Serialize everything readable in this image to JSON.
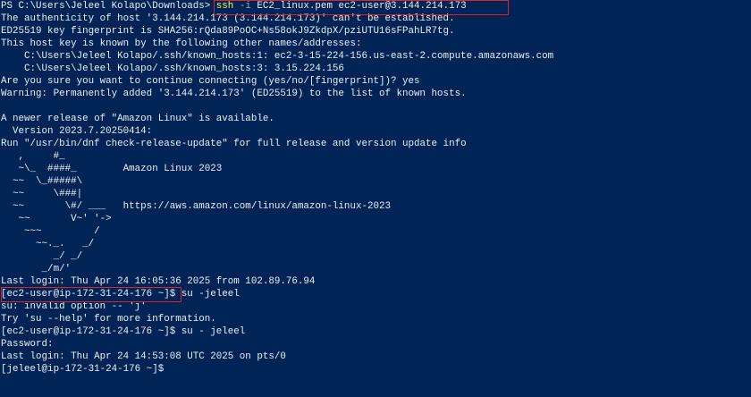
{
  "terminal": {
    "background": "#012456",
    "highlight_box_color": "#e0232b",
    "prompt_ps": "PS C:\\Users\\Jeleel Kolapo\\Downloads> ",
    "cmd_ssh": "ssh",
    "cmd_flag": " -i",
    "cmd_rest": " EC2_linux.pem ec2-user@3.144.214.173",
    "lines": [
      "The authenticity of host '3.144.214.173 (3.144.214.173)' can't be established.",
      "ED25519 key fingerprint is SHA256:rQda89PoOC+Ns58okJ9ZkdpX/pziUTU16sFPahLR7tg.",
      "This host key is known by the following other names/addresses:",
      "    C:\\Users\\Jeleel Kolapo/.ssh/known_hosts:1: ec2-3-15-224-156.us-east-2.compute.amazonaws.com",
      "    C:\\Users\\Jeleel Kolapo/.ssh/known_hosts:3: 3.15.224.156",
      "Are you sure you want to continue connecting (yes/no/[fingerprint])? yes",
      "Warning: Permanently added '3.144.214.173' (ED25519) to the list of known hosts.",
      "",
      "A newer release of \"Amazon Linux\" is available.",
      "  Version 2023.7.20250414:",
      "Run \"/usr/bin/dnf check-release-update\" for full release and version update info",
      "   ,     #_",
      "   ~\\_  ####_        Amazon Linux 2023",
      "  ~~  \\_#####\\",
      "  ~~     \\###|",
      "  ~~       \\#/ ___   https://aws.amazon.com/linux/amazon-linux-2023",
      "   ~~       V~' '->",
      "    ~~~         /",
      "      ~~._.   _/",
      "         _/ _/",
      "       _/m/'",
      "Last login: Thu Apr 24 16:05:36 2025 from 102.89.76.94",
      "[ec2-user@ip-172-31-24-176 ~]$ su -jeleel",
      "su: invalid option -- 'j'",
      "Try 'su --help' for more information.",
      "[ec2-user@ip-172-31-24-176 ~]$ su - jeleel",
      "Password:",
      "Last login: Thu Apr 24 14:53:08 UTC 2025 on pts/0",
      "[jeleel@ip-172-31-24-176 ~]$ "
    ]
  }
}
